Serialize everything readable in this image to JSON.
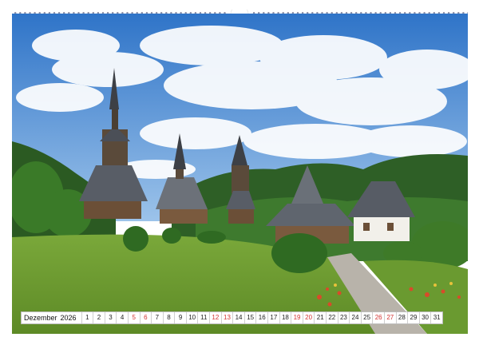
{
  "calendar": {
    "month": "Dezember",
    "year": "2026",
    "days": [
      "1",
      "2",
      "3",
      "4",
      "5",
      "6",
      "7",
      "8",
      "9",
      "10",
      "11",
      "12",
      "13",
      "14",
      "15",
      "16",
      "17",
      "18",
      "19",
      "20",
      "21",
      "22",
      "23",
      "24",
      "25",
      "26",
      "27",
      "28",
      "29",
      "30",
      "31"
    ],
    "weekend_days": [
      "5",
      "6",
      "12",
      "13",
      "19",
      "20",
      "26",
      "27"
    ]
  },
  "colors": {
    "weekend": "#d33333",
    "sky": "#4f8fd6",
    "grass": "#6d9a2e",
    "roof": "#5a5f66"
  }
}
